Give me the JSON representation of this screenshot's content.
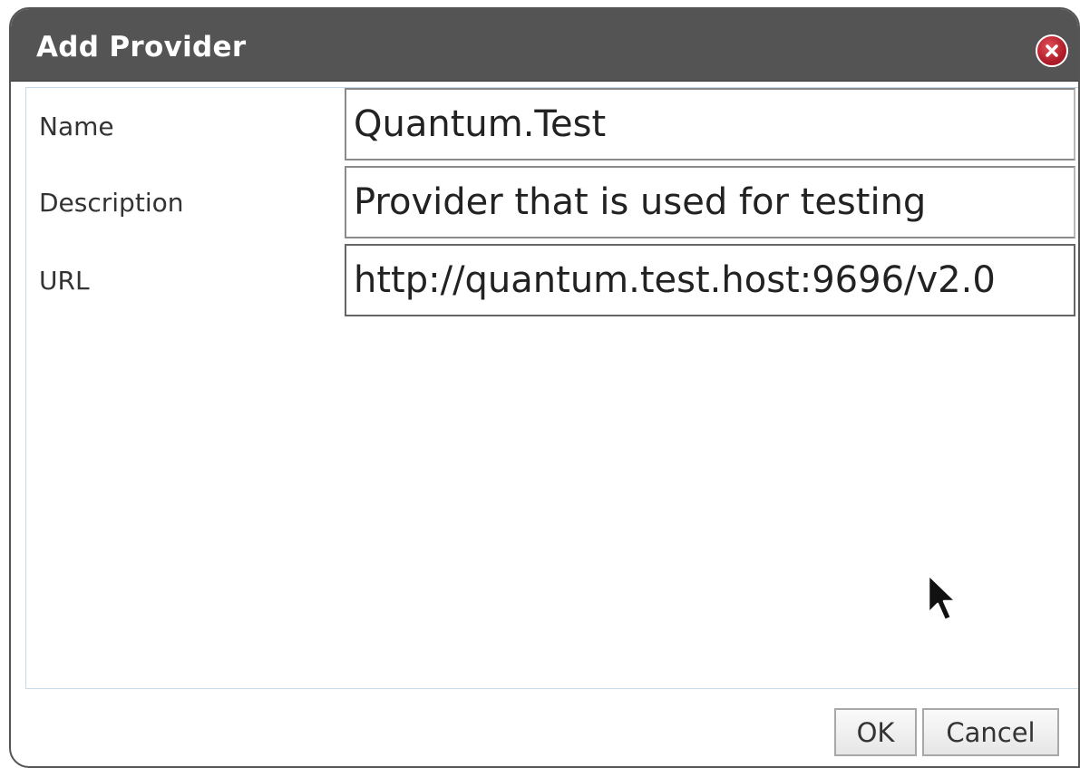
{
  "dialog": {
    "title": "Add Provider",
    "close_icon": "close-icon",
    "accent_close_color": "#b11d2a",
    "titlebar_color": "#545454"
  },
  "form": {
    "fields": [
      {
        "label": "Name",
        "value": "Quantum.Test"
      },
      {
        "label": "Description",
        "value": "Provider that is used for testing"
      },
      {
        "label": "URL",
        "value": "http://quantum.test.host:9696/v2.0"
      }
    ]
  },
  "footer": {
    "ok_label": "OK",
    "cancel_label": "Cancel"
  },
  "pointer": {
    "icon": "mouse-pointer-icon"
  }
}
